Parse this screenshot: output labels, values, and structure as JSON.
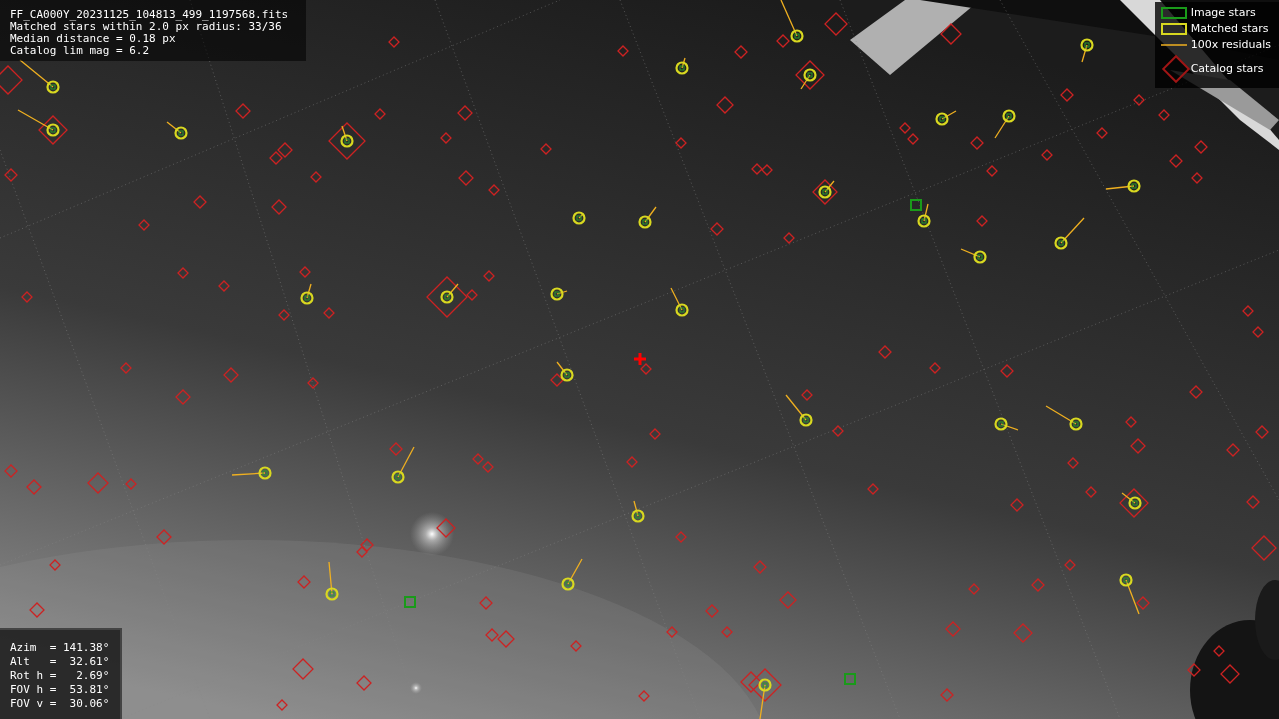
{
  "file_info": {
    "lines": [
      "FF_CA000Y_20231125_104813_499_1197568.fits",
      "Matched stars within 2.0 px radius: 33/36",
      "Median distance = 0.18 px",
      "Catalog lim mag = 6.2"
    ]
  },
  "legend": [
    {
      "label": "Image stars"
    },
    {
      "kind": "matched",
      "label": "Matched stars"
    },
    {
      "kind": "residual",
      "label": "100x residuals"
    },
    {
      "kind": "catalog",
      "label": "Catalog stars"
    }
  ],
  "pointing": [
    "Azim  = 141.38°",
    "Alt   =  32.61°",
    "Rot h =   2.69°",
    "FOV h =  53.81°",
    "FOV v =  30.06°"
  ]
}
